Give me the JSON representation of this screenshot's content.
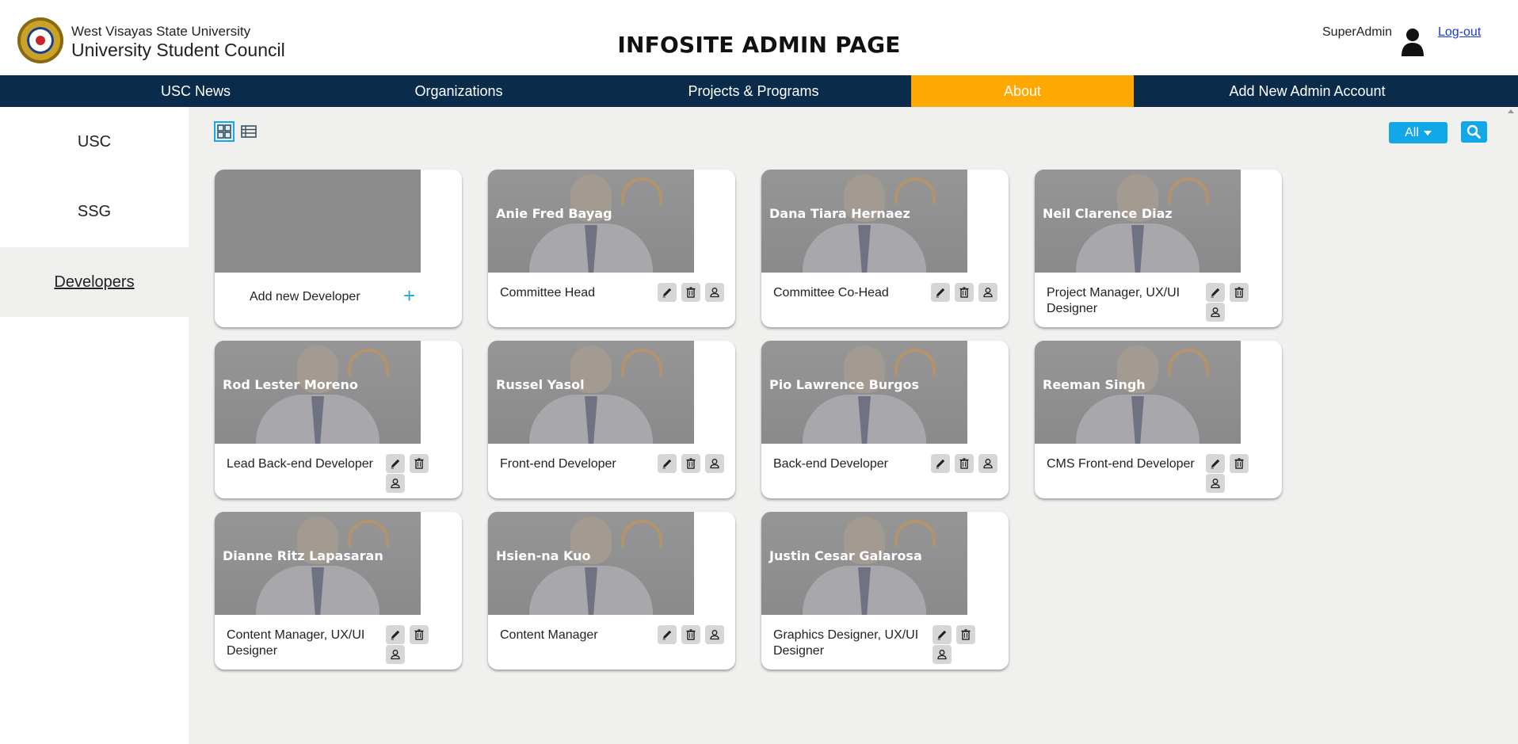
{
  "header": {
    "university": "West Visayas State University",
    "council": "University Student Council",
    "page_title": "INFOSITE ADMIN PAGE",
    "user_name": "SuperAdmin",
    "logout_label": "Log-out"
  },
  "nav": {
    "items": [
      {
        "label": "USC News"
      },
      {
        "label": "Organizations"
      },
      {
        "label": "Projects & Programs"
      },
      {
        "label": "About",
        "active": true
      },
      {
        "label": "Add New Admin Account"
      }
    ]
  },
  "sidebar": {
    "items": [
      {
        "label": "USC"
      },
      {
        "label": "SSG"
      },
      {
        "label": "Developers",
        "active": true
      }
    ]
  },
  "toolbar": {
    "filter_label": "All",
    "view_modes": [
      "grid-view-icon",
      "list-view-icon"
    ]
  },
  "add_card": {
    "label": "Add new Developer",
    "plus": "+"
  },
  "developers": [
    {
      "name": "Anie Fred Bayag",
      "role": "Committee Head"
    },
    {
      "name": "Dana Tiara Hernaez",
      "role": "Committee Co-Head"
    },
    {
      "name": "Neil Clarence Diaz",
      "role": "Project Manager, UX/UI Designer"
    },
    {
      "name": "Rod Lester Moreno",
      "role": "Lead Back-end Developer"
    },
    {
      "name": "Russel Yasol",
      "role": "Front-end Developer"
    },
    {
      "name": "Pio Lawrence Burgos",
      "role": "Back-end Developer"
    },
    {
      "name": "Reeman Singh",
      "role": "CMS Front-end Developer"
    },
    {
      "name": "Dianne Ritz Lapasaran",
      "role": "Content Manager, UX/UI Designer"
    },
    {
      "name": "Hsien-na Kuo",
      "role": "Content Manager"
    },
    {
      "name": "Justin Cesar Galarosa",
      "role": "Graphics Designer, UX/UI Designer"
    }
  ],
  "colors": {
    "nav_bg": "#0b2b4a",
    "nav_active": "#ffa801",
    "accent": "#12a7e8",
    "link": "#1a3ad1"
  }
}
